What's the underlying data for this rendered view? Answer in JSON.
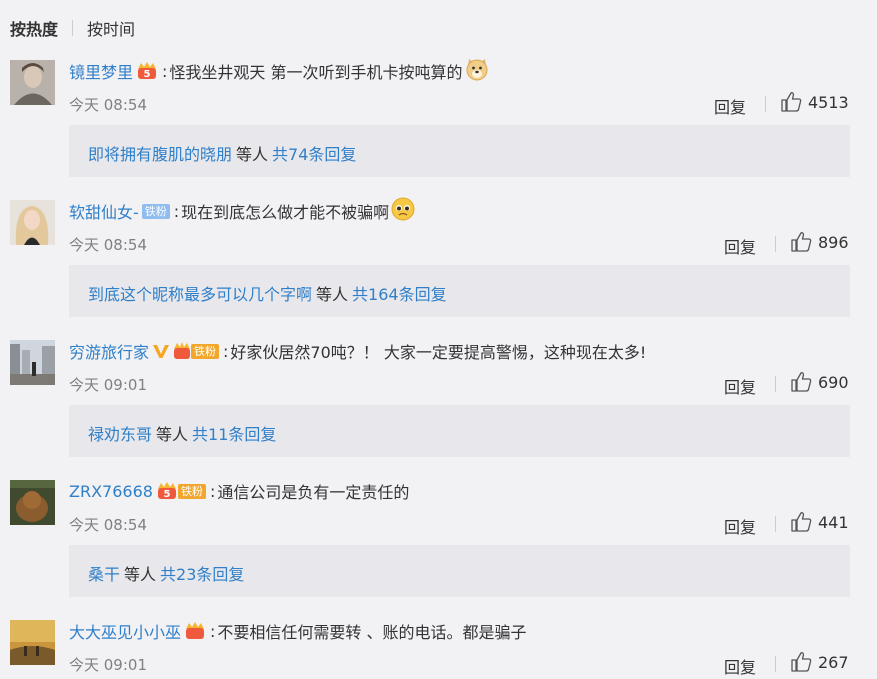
{
  "sort_tabs": {
    "hot": "按热度",
    "time": "按时间"
  },
  "reply_label": "回复",
  "comments": [
    {
      "username": "镜里梦里",
      "level_badge": "5",
      "fan_badge": "",
      "text": "怪我坐井观天 第一次听到手机卡按吨算的",
      "emoji": "doge-icon",
      "time": "今天 08:54",
      "likes": "4513",
      "reply_preview_name": "即将拥有腹肌的晓朋",
      "reply_preview_wait": "等人",
      "reply_total": "共74条回复"
    },
    {
      "username": "软甜仙女-",
      "level_badge": "",
      "fan_badge": "铁粉",
      "text": "现在到底怎么做才能不被骗啊",
      "emoji": "pleading-face-icon",
      "time": "今天 08:54",
      "likes": "896",
      "reply_preview_name": "到底这个昵称最多可以几个字啊",
      "reply_preview_wait": "等人",
      "reply_total": "共164条回复"
    },
    {
      "username": "穷游旅行家",
      "level_badge": "",
      "fan_badge": "铁粉",
      "text": "好家伙居然70吨？！ 大家一定要提高警惕，这种现在太多!",
      "emoji": "",
      "time": "今天 09:01",
      "likes": "690",
      "reply_preview_name": "禄劝东哥",
      "reply_preview_wait": "等人",
      "reply_total": "共11条回复"
    },
    {
      "username": "ZRX76668",
      "level_badge": "5",
      "fan_badge": "铁粉",
      "text": "通信公司是负有一定责任的",
      "emoji": "",
      "time": "今天 08:54",
      "likes": "441",
      "reply_preview_name": "桑干",
      "reply_preview_wait": "等人",
      "reply_total": "共23条回复"
    },
    {
      "username": "大大巫见小小巫",
      "level_badge": "",
      "fan_badge": "",
      "text": "不要相信任何需要转 、账的电话。都是骗子",
      "emoji": "",
      "time": "今天 09:01",
      "likes": "267"
    }
  ],
  "colors": {
    "link": "#2f7fc9",
    "text": "#333333",
    "muted": "#808080",
    "bg": "#f2f2f5",
    "reply_bg": "#e8e8ec"
  }
}
